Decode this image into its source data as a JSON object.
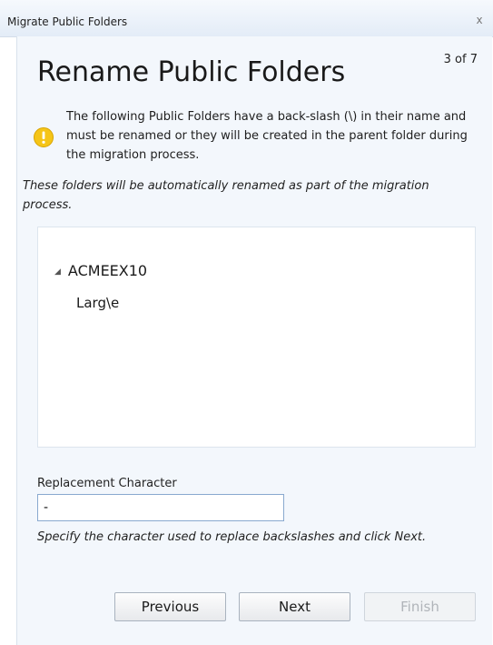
{
  "window": {
    "title": "Migrate Public Folders",
    "close_glyph": "x"
  },
  "page": {
    "heading": "Rename Public Folders",
    "step": "3 of 7"
  },
  "warning": {
    "icon": "warning-icon",
    "icon_color": "#f5c518",
    "text": "The following Public Folders have a back-slash (\\) in their name and must be renamed or they will be created in the parent folder during the migration process."
  },
  "note": "These folders will be automatically renamed as part of the migration process.",
  "tree": {
    "root": {
      "label": "ACMEEX10",
      "expander": "◢"
    },
    "children": [
      {
        "label": "Larg\\e"
      }
    ]
  },
  "replacement": {
    "label": "Replacement Character",
    "value": "-",
    "hint": "Specify the character used to replace backslashes and click Next."
  },
  "buttons": {
    "previous": "Previous",
    "next": "Next",
    "finish": "Finish"
  },
  "colors": {
    "panel_bg": "#f3f7fc",
    "input_border": "#89a9cf"
  }
}
